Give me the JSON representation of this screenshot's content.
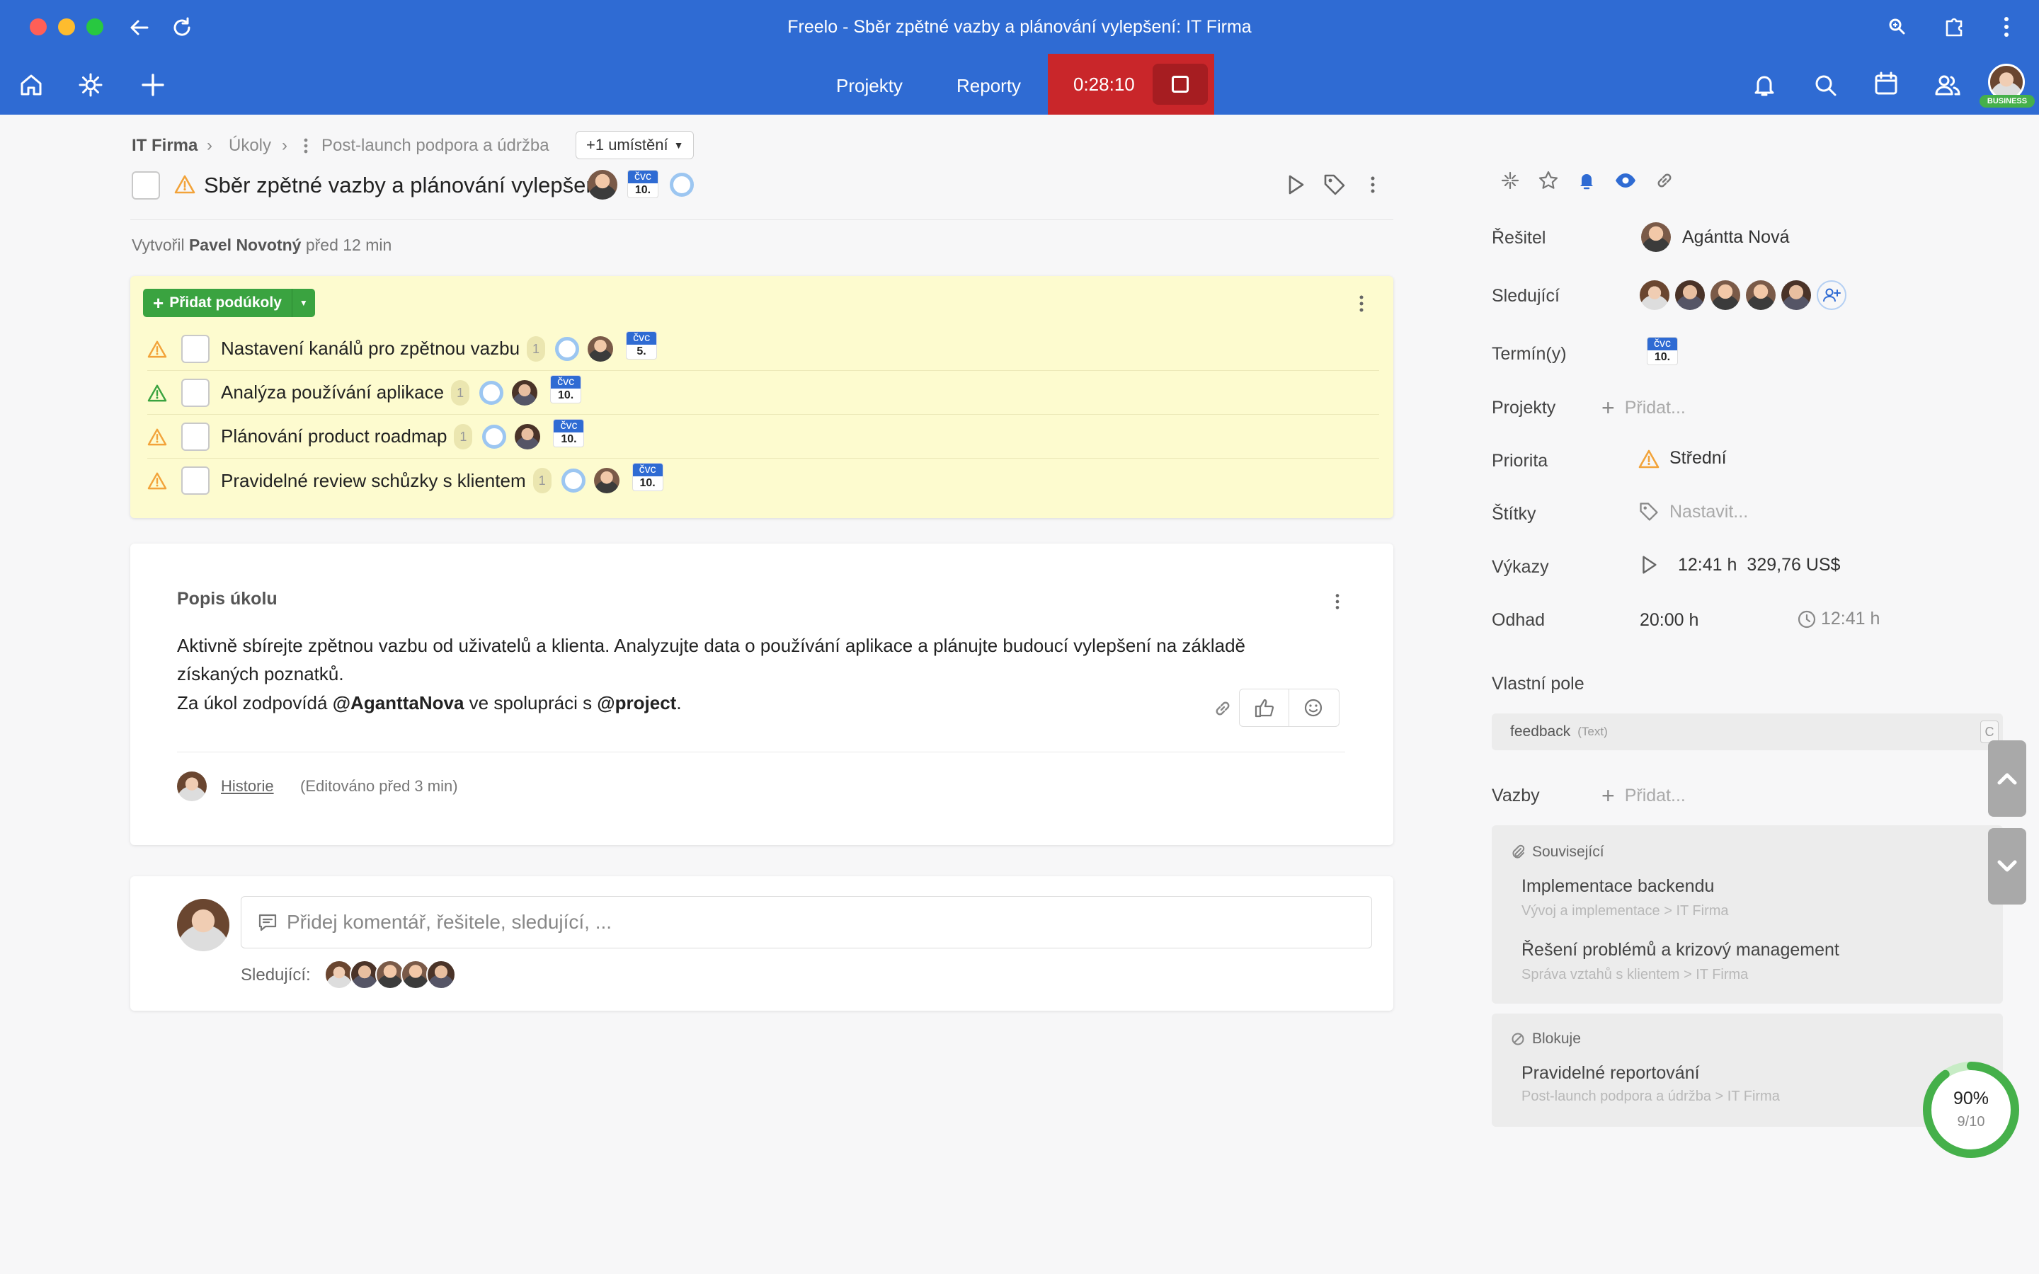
{
  "window": {
    "title": "Freelo - Sběr zpětné vazby a plánování vylepšení: IT Firma"
  },
  "appbar": {
    "nav_projects": "Projekty",
    "nav_reports": "Reporty",
    "timer": "0:28:10",
    "business_badge": "BUSINESS"
  },
  "breadcrumb": {
    "company": "IT Firma",
    "tasks": "Úkoly",
    "list": "Post-launch podpora a údržba",
    "more": "+1 umístění"
  },
  "task": {
    "title": "Sběr zpětné vazby a plánování vylepšení",
    "date_month": "čvc",
    "date_day": "10.",
    "created_by_prefix": "Vytvořil",
    "created_by_name": "Pavel Novotný",
    "created_ago": "před 12 min"
  },
  "subtasks": {
    "add_label": "Přidat podúkoly",
    "items": [
      {
        "label": "Nastavení kanálů pro zpětnou vazbu",
        "count": "1",
        "month": "čvc",
        "day": "5."
      },
      {
        "label": "Analýza používání aplikace",
        "count": "1",
        "month": "čvc",
        "day": "10."
      },
      {
        "label": "Plánování product roadmap",
        "count": "1",
        "month": "čvc",
        "day": "10."
      },
      {
        "label": "Pravidelné review schůzky s klientem",
        "count": "1",
        "month": "čvc",
        "day": "10."
      }
    ]
  },
  "description": {
    "title": "Popis úkolu",
    "line1": "Aktivně sbírejte zpětnou vazbu od uživatelů a klienta. Analyzujte data o používání aplikace a plánujte budoucí vylepšení na základě",
    "line2": "získaných poznatků.",
    "line3_prefix": "Za úkol zodpovídá ",
    "mention_user": "@AganttaNova",
    "line3_mid": " ve spolupráci s ",
    "mention_project": "@project",
    "line3_end": ".",
    "history_link": "Historie",
    "edited": "(Editováno před 3 min)"
  },
  "comment": {
    "placeholder": "Přidej komentář, řešitele, sledující, ...",
    "followers_label": "Sledující:"
  },
  "panel": {
    "assignee_label": "Řešitel",
    "assignee_name": "Agántta Nová",
    "followers_label": "Sledující",
    "due_label": "Termín(y)",
    "due_month": "čvc",
    "due_day": "10.",
    "projects_label": "Projekty",
    "projects_add": "Přidat...",
    "priority_label": "Priorita",
    "priority_value": "Střední",
    "tags_label": "Štítky",
    "tags_value": "Nastavit...",
    "reports_label": "Výkazy",
    "reports_time": "12:41 h",
    "reports_money": "329,76 US$",
    "estimate_label": "Odhad",
    "estimate_value": "20:00 h",
    "estimate_spent": "12:41 h",
    "custom_label": "Vlastní pole",
    "custom_field_name": "feedback",
    "custom_field_type": "(Text)",
    "custom_field_key": "C",
    "relations_label": "Vazby",
    "relations_add": "Přidat...",
    "related_header": "Související",
    "related": [
      {
        "title": "Implementace backendu",
        "path1": "Vývoj a implementace",
        "path2": "IT Firma"
      },
      {
        "title": "Řešení problémů a krizový management",
        "path1": "Správa vztahů s klientem",
        "path2": "IT Firma"
      }
    ],
    "blocks_header": "Blokuje",
    "blocks": [
      {
        "title": "Pravidelné reportování",
        "path1": "Post-launch podpora a údržba",
        "path2": "IT Firma"
      }
    ]
  },
  "progress": {
    "percent_label": "90%",
    "fraction_label": "9/10",
    "fraction": 0.9
  },
  "colors": {
    "brand_blue": "#2f6bd3",
    "timer_red": "#c9262a",
    "add_green": "#3aa340",
    "subtasks_bg": "#fdfbcf",
    "warning_orange": "#f2a33a"
  }
}
